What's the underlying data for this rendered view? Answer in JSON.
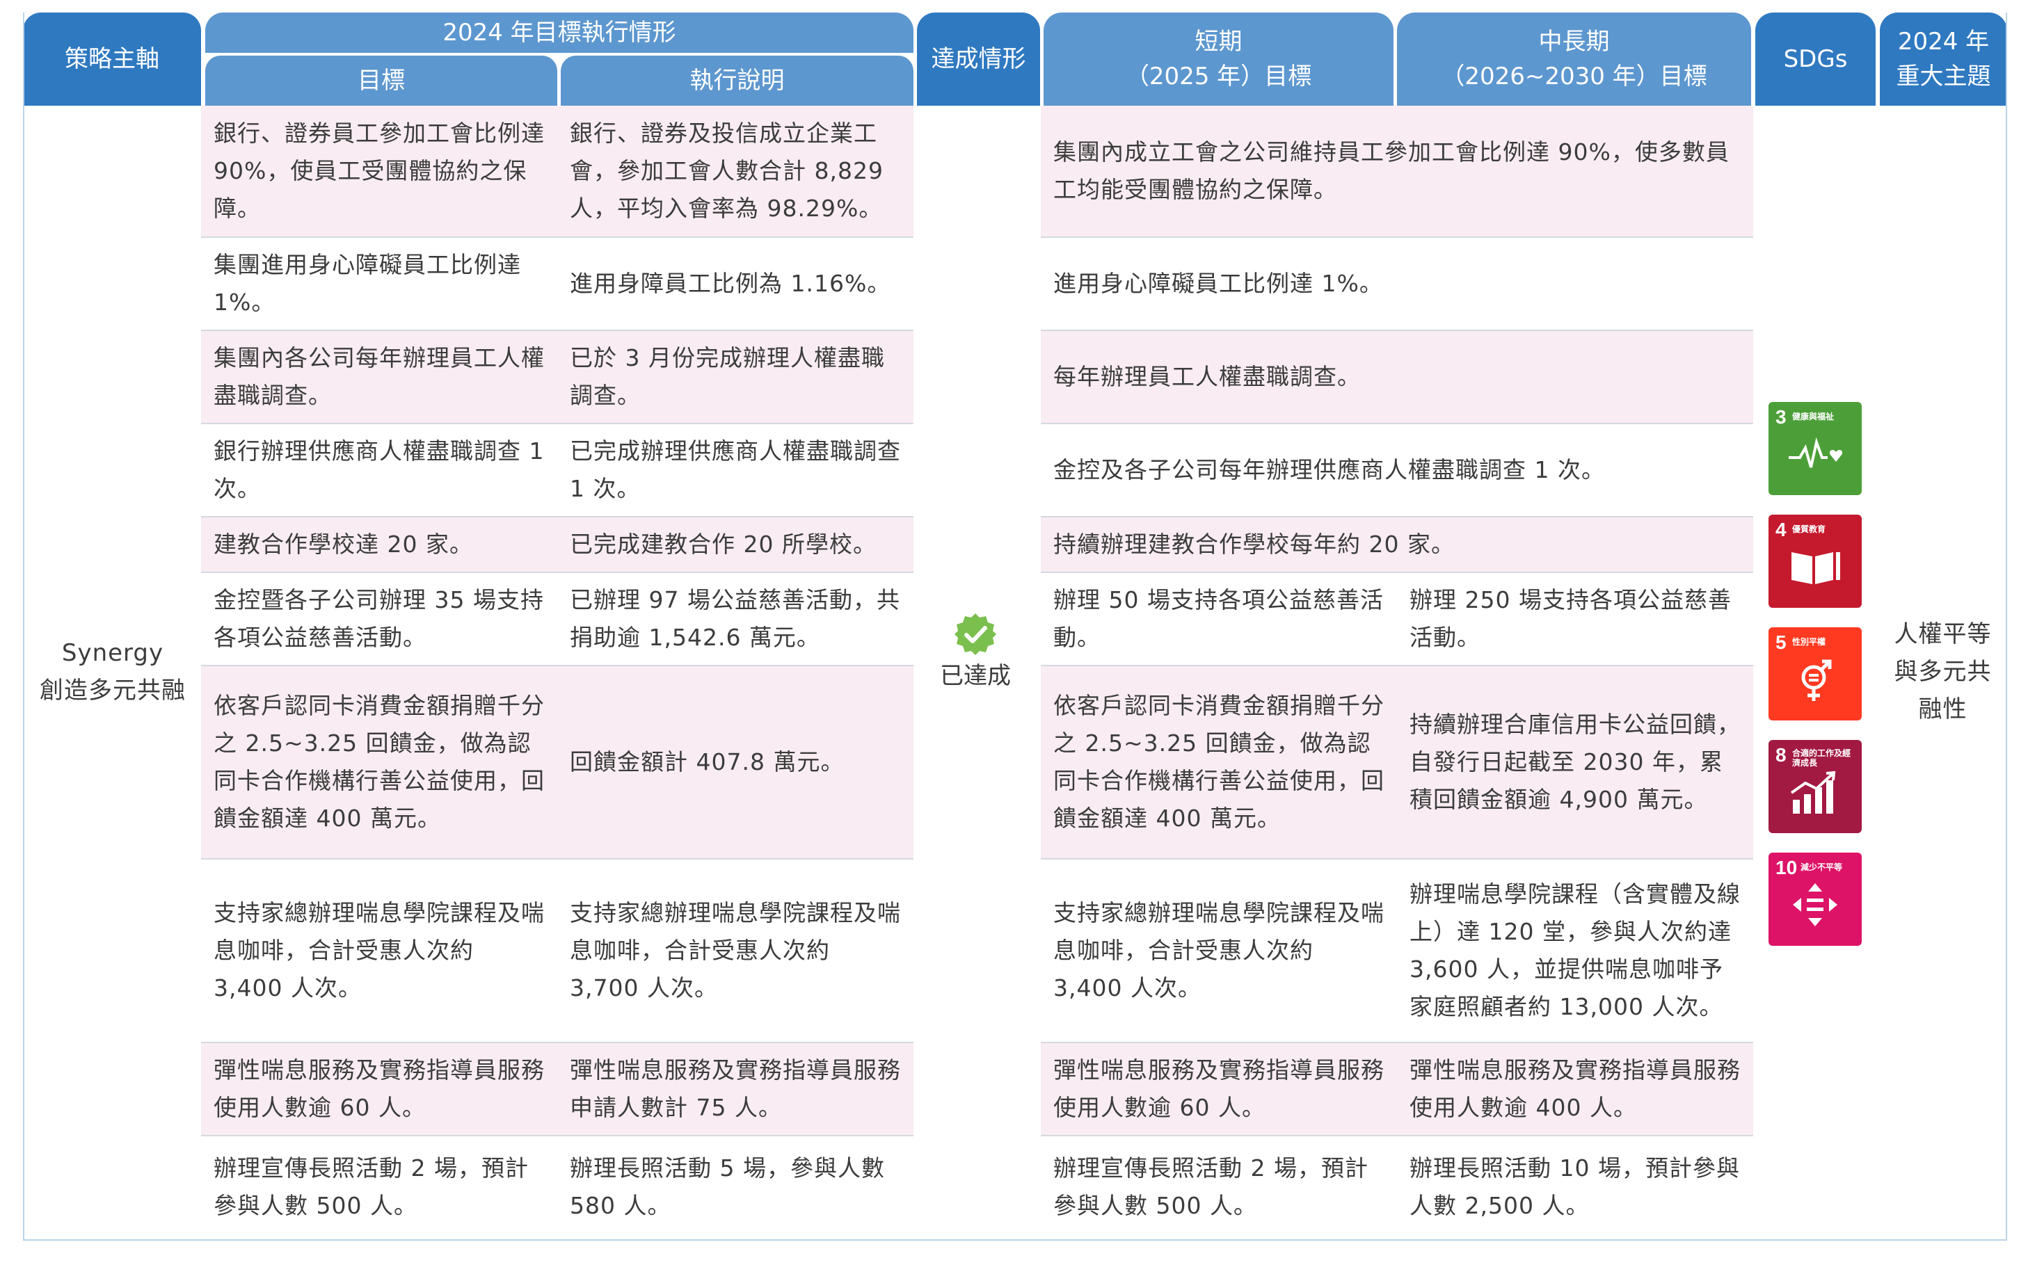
{
  "header": {
    "strategy": "策略主軸",
    "execution_2024": "2024 年目標執行情形",
    "goal": "目標",
    "description": "執行說明",
    "achievement": "達成情形",
    "short_term_line1": "短期",
    "short_term_line2": "（2025 年）目標",
    "mid_long_line1": "中長期",
    "mid_long_line2": "（2026~2030 年）目標",
    "sdgs": "SDGs",
    "major_topic_line1": "2024 年",
    "major_topic_line2": "重大主題"
  },
  "strategy": {
    "line1": "Synergy",
    "line2": "創造多元共融"
  },
  "achievement": {
    "label": "已達成",
    "icon": "check-badge-icon",
    "color": "#7bbf4e"
  },
  "major_topic": {
    "line1": "人權平等",
    "line2": "與多元共",
    "line3": "融性"
  },
  "rows": [
    {
      "goal": "銀行、證券員工參加工會比例達 90%，使員工受團體協約之保障。",
      "description": "銀行、證券及投信成立企業工會，參加工會人數合計 8,829 人，平均入會率為 98.29%。",
      "short_term": "集團內成立工會之公司維持員工參加工會比例達 90%，使多數員工均能受團體協約之保障。",
      "mid_long": ""
    },
    {
      "goal": "集團進用身心障礙員工比例達 1%。",
      "description": "進用身障員工比例為 1.16%。",
      "short_term": "進用身心障礙員工比例達 1%。",
      "mid_long": ""
    },
    {
      "goal": "集團內各公司每年辦理員工人權盡職調查。",
      "description": "已於 3 月份完成辦理人權盡職調查。",
      "short_term": "每年辦理員工人權盡職調查。",
      "mid_long": ""
    },
    {
      "goal": "銀行辦理供應商人權盡職調查 1 次。",
      "description": "已完成辦理供應商人權盡職調查 1 次。",
      "short_term": "金控及各子公司每年辦理供應商人權盡職調查 1 次。",
      "mid_long": ""
    },
    {
      "goal": "建教合作學校達 20 家。",
      "description": "已完成建教合作 20 所學校。",
      "short_term": "持續辦理建教合作學校每年約 20 家。",
      "mid_long": ""
    },
    {
      "goal": "金控暨各子公司辦理 35 場支持各項公益慈善活動。",
      "description": "已辦理 97 場公益慈善活動，共捐助逾 1,542.6 萬元。",
      "short_term": "辦理 50 場支持各項公益慈善活動。",
      "mid_long": "辦理 250 場支持各項公益慈善活動。"
    },
    {
      "goal": "依客戶認同卡消費金額捐贈千分之 2.5~3.25 回饋金，做為認同卡合作機構行善公益使用，回饋金額達 400 萬元。",
      "description": "回饋金額計 407.8 萬元。",
      "short_term": "依客戶認同卡消費金額捐贈千分之 2.5~3.25 回饋金，做為認同卡合作機構行善公益使用，回饋金額達 400 萬元。",
      "mid_long": "持續辦理合庫信用卡公益回饋，自發行日起截至 2030 年，累積回饋金額逾 4,900 萬元。"
    },
    {
      "goal": "支持家總辦理喘息學院課程及喘息咖啡，合計受惠人次約 3,400 人次。",
      "description": "支持家總辦理喘息學院課程及喘息咖啡，合計受惠人次約 3,700 人次。",
      "short_term": "支持家總辦理喘息學院課程及喘息咖啡，合計受惠人次約 3,400 人次。",
      "mid_long": "辦理喘息學院課程（含實體及線上）達 120 堂，參與人次約達 3,600 人，並提供喘息咖啡予家庭照顧者約 13,000 人次。"
    },
    {
      "goal": "彈性喘息服務及實務指導員服務使用人數逾 60 人。",
      "description": "彈性喘息服務及實務指導員服務申請人數計 75 人。",
      "short_term": "彈性喘息服務及實務指導員服務使用人數逾 60 人。",
      "mid_long": "彈性喘息服務及實務指導員服務使用人數逾 400 人。"
    },
    {
      "goal": "辦理宣傳長照活動 2 場，預計參與人數 500 人。",
      "description": "辦理長照活動 5 場，參與人數 580 人。",
      "short_term": "辦理宣傳長照活動 2 場，預計參與人數 500 人。",
      "mid_long": "辦理長照活動 10 場，預計參與人數 2,500 人。"
    }
  ],
  "sdgs": [
    {
      "number": "3",
      "caption": "健康與福祉",
      "color": "#4c9f38",
      "icon": "heartbeat-icon"
    },
    {
      "number": "4",
      "caption": "優質教育",
      "color": "#c5192d",
      "icon": "book-icon"
    },
    {
      "number": "5",
      "caption": "性別平權",
      "color": "#ff3a21",
      "icon": "gender-equality-icon"
    },
    {
      "number": "8",
      "caption": "合適的工作及經濟成長",
      "color": "#a21942",
      "icon": "growth-chart-icon"
    },
    {
      "number": "10",
      "caption": "減少不平等",
      "color": "#dd1367",
      "icon": "reduced-inequality-icon"
    }
  ]
}
